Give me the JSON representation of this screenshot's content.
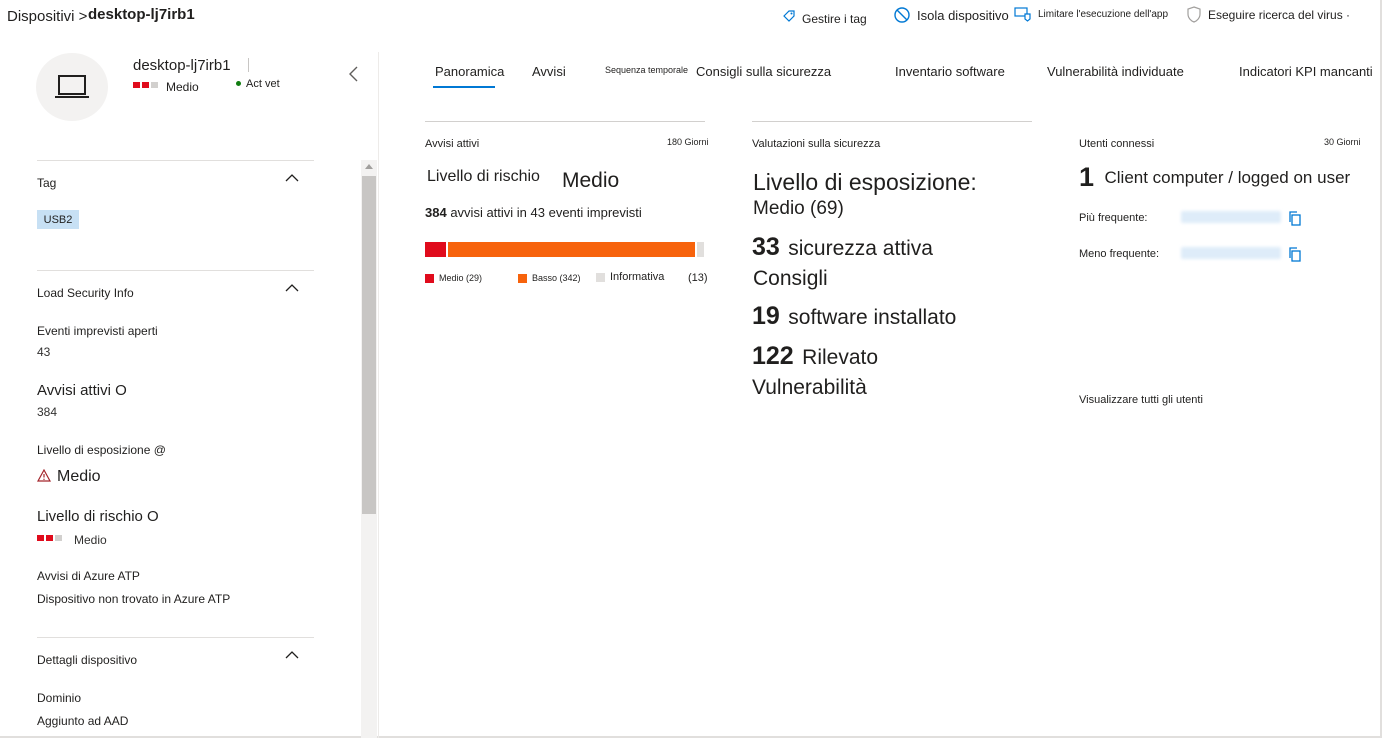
{
  "header": {
    "breadcrumb": "Dispositivi &gt;",
    "device": "desktop-lj7irb1",
    "actions": {
      "manage_tags": "Gestire i tag",
      "isolate": "Isola dispositivo",
      "restrict_app": "Limitare l'esecuzione dell'app",
      "antivirus": "Eseguire ricerca del virus ·"
    }
  },
  "device": {
    "name": "desktop-lj7irb1",
    "risk": "Medio",
    "status": "Act vet"
  },
  "left": {
    "tags": {
      "title": "Tag",
      "pill": "USB2"
    },
    "security": {
      "title": "Load Security Info",
      "open_incidents_label": "Eventi imprevisti aperti",
      "open_incidents_value": "43",
      "active_alerts_label": "Avvisi attivi O",
      "active_alerts_value": "384",
      "exposure_label": "Livello di esposizione @",
      "exposure_value": "Medio",
      "risk_label": "Livello di rischio O",
      "risk_value": "Medio",
      "azure_label": "Avvisi di Azure ATP",
      "azure_value": "Dispositivo non trovato in Azure ATP"
    },
    "details": {
      "title": "Dettagli dispositivo",
      "domain_label": "Dominio",
      "domain_value": "Aggiunto ad AAD"
    }
  },
  "tabs": [
    "Panoramica",
    "Avvisi",
    "Sequenza temporale",
    "Consigli sulla sicurezza",
    "Inventario software",
    "Vulnerabilità individuate",
    "Indicatori KPI mancanti"
  ],
  "alerts_card": {
    "title": "Avvisi attivi",
    "period": "180 Giorni",
    "risk_label": "Livello di rischio",
    "risk_value": "Medio",
    "count": "384",
    "count_text": "avvisi attivi in 43 eventi imprevisti",
    "segments": [
      {
        "label": "Medio (29)",
        "value": 29,
        "color": "#e00b1c"
      },
      {
        "label": "Basso (342)",
        "value": 342,
        "color": "#f7630c"
      },
      {
        "label": "Informativa",
        "value": 13,
        "color": "#e1dfdd"
      }
    ],
    "info_count": "(13)"
  },
  "security_card": {
    "title": "Valutazioni sulla sicurezza",
    "exposure_line1": "Livello di esposizione:",
    "exposure_line2": "Medio (69)",
    "rec_count": "33",
    "rec_line1": "sicurezza attiva",
    "rec_line2": "Consigli",
    "sw_count": "19",
    "sw_text": "software installato",
    "vuln_count": "122",
    "vuln_line1": "Rilevato",
    "vuln_line2": "Vulnerabilità"
  },
  "users_card": {
    "title": "Utenti connessi",
    "period": "30 Giorni",
    "count": "1",
    "count_text": "Client computer / logged on user",
    "most_label": "Più frequente:",
    "least_label": "Meno frequente:",
    "view_all": "Visualizzare tutti gli utenti"
  },
  "colors": {
    "accent": "#0078d4",
    "risk_red": "#e00b1c",
    "low_orange": "#f7630c",
    "tag_bg": "#c7e0f4"
  }
}
